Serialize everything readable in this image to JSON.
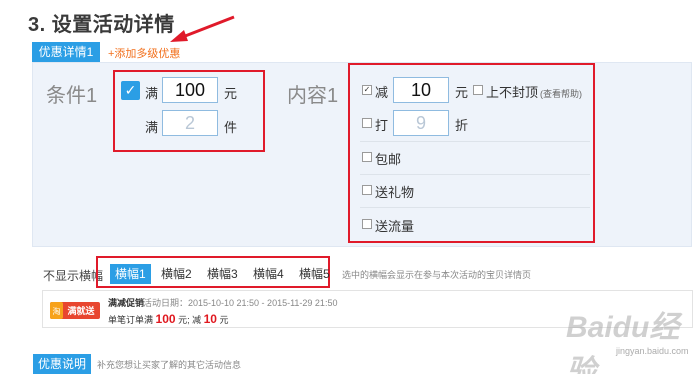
{
  "header": {
    "title": "3. 设置活动详情",
    "active_tab": "优惠详情1",
    "add_link": "+添加多级优惠"
  },
  "condition": {
    "label": "条件1",
    "full_label": "满",
    "full_value": "100",
    "full_unit": "元",
    "count_label": "满",
    "count_placeholder": "2",
    "count_unit": "件"
  },
  "content": {
    "label": "内容1",
    "reduce_label": "减",
    "reduce_value": "10",
    "reduce_unit": "元",
    "no_cap_label": "上不封顶",
    "help_label": "(查看帮助)",
    "discount_label": "打",
    "discount_placeholder": "9",
    "discount_unit": "折",
    "free_shipping_label": "包邮",
    "gift_label": "送礼物",
    "traffic_label": "送流量"
  },
  "banner": {
    "no_banner_label": "不显示横幅",
    "tabs": [
      "横幅1",
      "横幅2",
      "横幅3",
      "横幅4",
      "横幅5"
    ],
    "note": "选中的横幅会显示在参与本次活动的宝贝详情页"
  },
  "preview": {
    "badge_text": "满就送",
    "badge_corner": "淘",
    "name": "满减促销",
    "date": "活动日期：2015-10-10 21:50 - 2015-11-29 21:50",
    "rule_prefix": "单笔订单满",
    "rule_amount": "100",
    "rule_middle": "元; 减",
    "rule_discount": "10",
    "rule_suffix": "元"
  },
  "description": {
    "button": "优惠说明",
    "hint": "补充您想让买家了解的其它活动信息"
  },
  "watermark": {
    "logo": "Baidu经验",
    "url": "jingyan.baidu.com"
  },
  "colors": {
    "accent": "#2b9ee5",
    "highlight_box": "#e01a2a",
    "link": "#f2701d"
  }
}
